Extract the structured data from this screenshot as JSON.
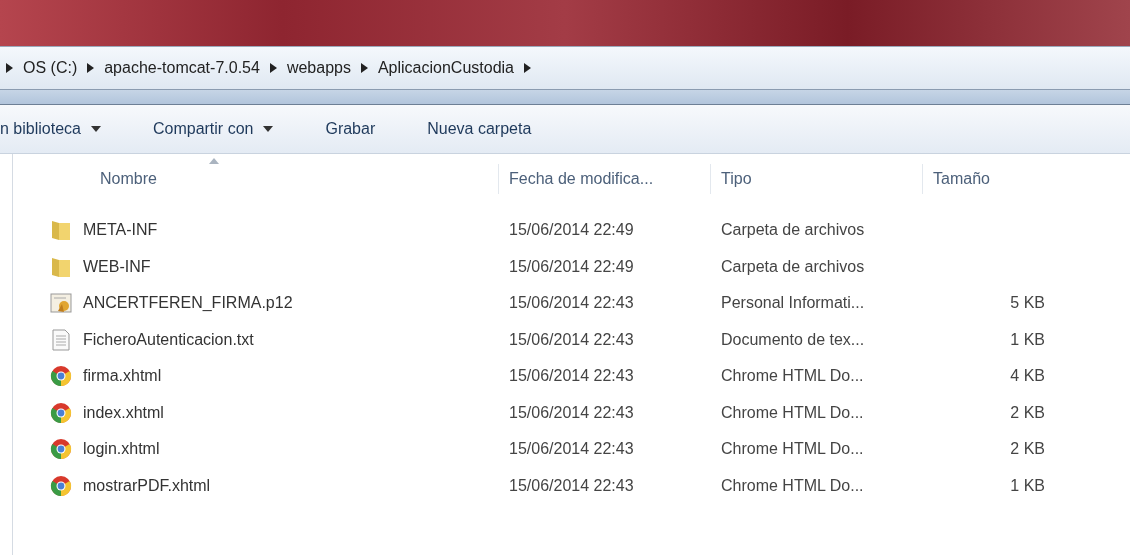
{
  "address_bar": {
    "crumbs": [
      "OS (C:)",
      "apache-tomcat-7.0.54",
      "webapps",
      "AplicacionCustodia"
    ]
  },
  "toolbar": [
    {
      "label": "n biblioteca",
      "dropdown": true
    },
    {
      "label": "Compartir con",
      "dropdown": true
    },
    {
      "label": "Grabar",
      "dropdown": false
    },
    {
      "label": "Nueva carpeta",
      "dropdown": false
    }
  ],
  "table": {
    "columns": [
      "Nombre",
      "Fecha de modifica...",
      "Tipo",
      "Tamaño"
    ],
    "rows": [
      {
        "kind": "folder",
        "name": "META-INF",
        "date": "15/06/2014 22:49",
        "type": "Carpeta de archivos"
      },
      {
        "kind": "folder",
        "name": "WEB-INF",
        "date": "15/06/2014 22:49",
        "type": "Carpeta de archivos"
      },
      {
        "kind": "certificate",
        "name": "ANCERTFEREN_FIRMA.p12",
        "date": "15/06/2014 22:43",
        "type": "Personal Informati...",
        "size": "5 KB"
      },
      {
        "kind": "text",
        "name": "FicheroAutenticacion.txt",
        "date": "15/06/2014 22:43",
        "type": "Documento de tex...",
        "size": "1 KB"
      },
      {
        "kind": "chrome",
        "name": "firma.xhtml",
        "date": "15/06/2014 22:43",
        "type": "Chrome HTML Do...",
        "size": "4 KB"
      },
      {
        "kind": "chrome",
        "name": "index.xhtml",
        "date": "15/06/2014 22:43",
        "type": "Chrome HTML Do...",
        "size": "2 KB"
      },
      {
        "kind": "chrome",
        "name": "login.xhtml",
        "date": "15/06/2014 22:43",
        "type": "Chrome HTML Do...",
        "size": "2 KB"
      },
      {
        "kind": "chrome",
        "name": "mostrarPDF.xhtml",
        "date": "15/06/2014 22:43",
        "type": "Chrome HTML Do...",
        "size": "1 KB"
      }
    ]
  }
}
